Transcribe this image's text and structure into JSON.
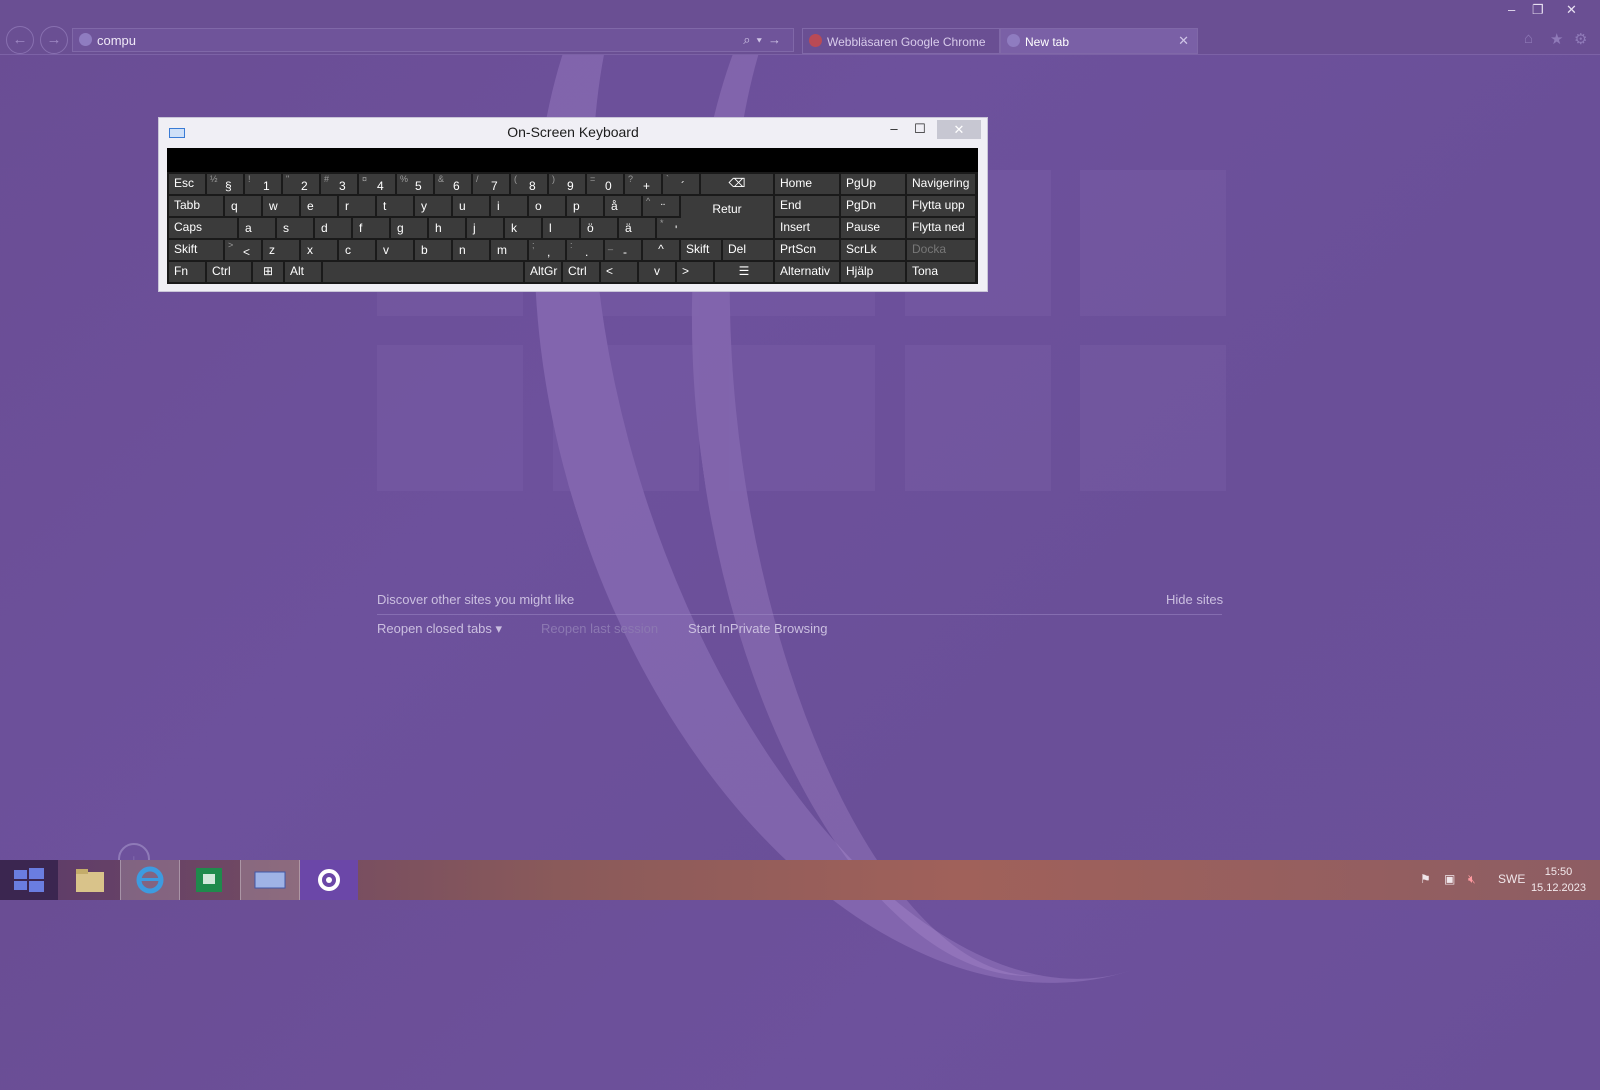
{
  "browser": {
    "address": "compu",
    "tabs": [
      "Webbläsaren Google Chrome",
      "New tab"
    ],
    "tab_close": "✕"
  },
  "osk": {
    "title": "On-Screen Keyboard",
    "close": "✕",
    "rows": {
      "r1": [
        "Esc",
        "§",
        "1",
        "2",
        "3",
        "4",
        "5",
        "6",
        "7",
        "8",
        "9",
        "0",
        "+",
        "´"
      ],
      "r1_shift": [
        "",
        "½",
        "!",
        "\"",
        "#",
        "¤",
        "%",
        "&",
        "/",
        "(",
        ")",
        "=",
        "?",
        "`"
      ],
      "r2": [
        "Tabb",
        "q",
        "w",
        "e",
        "r",
        "t",
        "y",
        "u",
        "i",
        "o",
        "p",
        "å",
        "¨",
        "Retur"
      ],
      "r2_shift": [
        "",
        "",
        "",
        "",
        "",
        "",
        "",
        "",
        "",
        "",
        "",
        "",
        "^",
        ""
      ],
      "r3": [
        "Caps",
        "a",
        "s",
        "d",
        "f",
        "g",
        "h",
        "j",
        "k",
        "l",
        "ö",
        "ä",
        "'"
      ],
      "r3_shift": [
        "",
        "",
        "",
        "",
        "",
        "",
        "",
        "",
        "",
        "",
        "",
        "",
        "*"
      ],
      "r4": [
        "Skift",
        "<",
        "z",
        "x",
        "c",
        "v",
        "b",
        "n",
        "m",
        ",",
        ".",
        "-",
        "^",
        "Skift",
        "Del"
      ],
      "r4_shift": [
        "",
        ">",
        "",
        "",
        "",
        "",
        "",
        "",
        "",
        ";",
        ":",
        "_",
        "",
        "",
        ""
      ],
      "r5": [
        "Fn",
        "Ctrl",
        "",
        "Alt",
        "",
        "AltGr",
        "Ctrl",
        "<",
        "v",
        ">",
        ""
      ]
    },
    "nav": [
      [
        "Home",
        "PgUp",
        "Navigering"
      ],
      [
        "End",
        "PgDn",
        "Flytta upp"
      ],
      [
        "Insert",
        "Pause",
        "Flytta ned"
      ],
      [
        "PrtScn",
        "ScrLk",
        "Docka"
      ],
      [
        "Alternativ",
        "Hjälp",
        "Tona"
      ]
    ]
  },
  "ntp": {
    "discover": "Discover other sites you might like",
    "hide": "Hide sites",
    "reopen": "Reopen closed tabs ▾",
    "reopen_last": "Reopen last session",
    "inprivate": "Start InPrivate Browsing"
  },
  "taskbar": {
    "lang": "SWE",
    "time": "15:50",
    "date": "15.12.2023"
  }
}
